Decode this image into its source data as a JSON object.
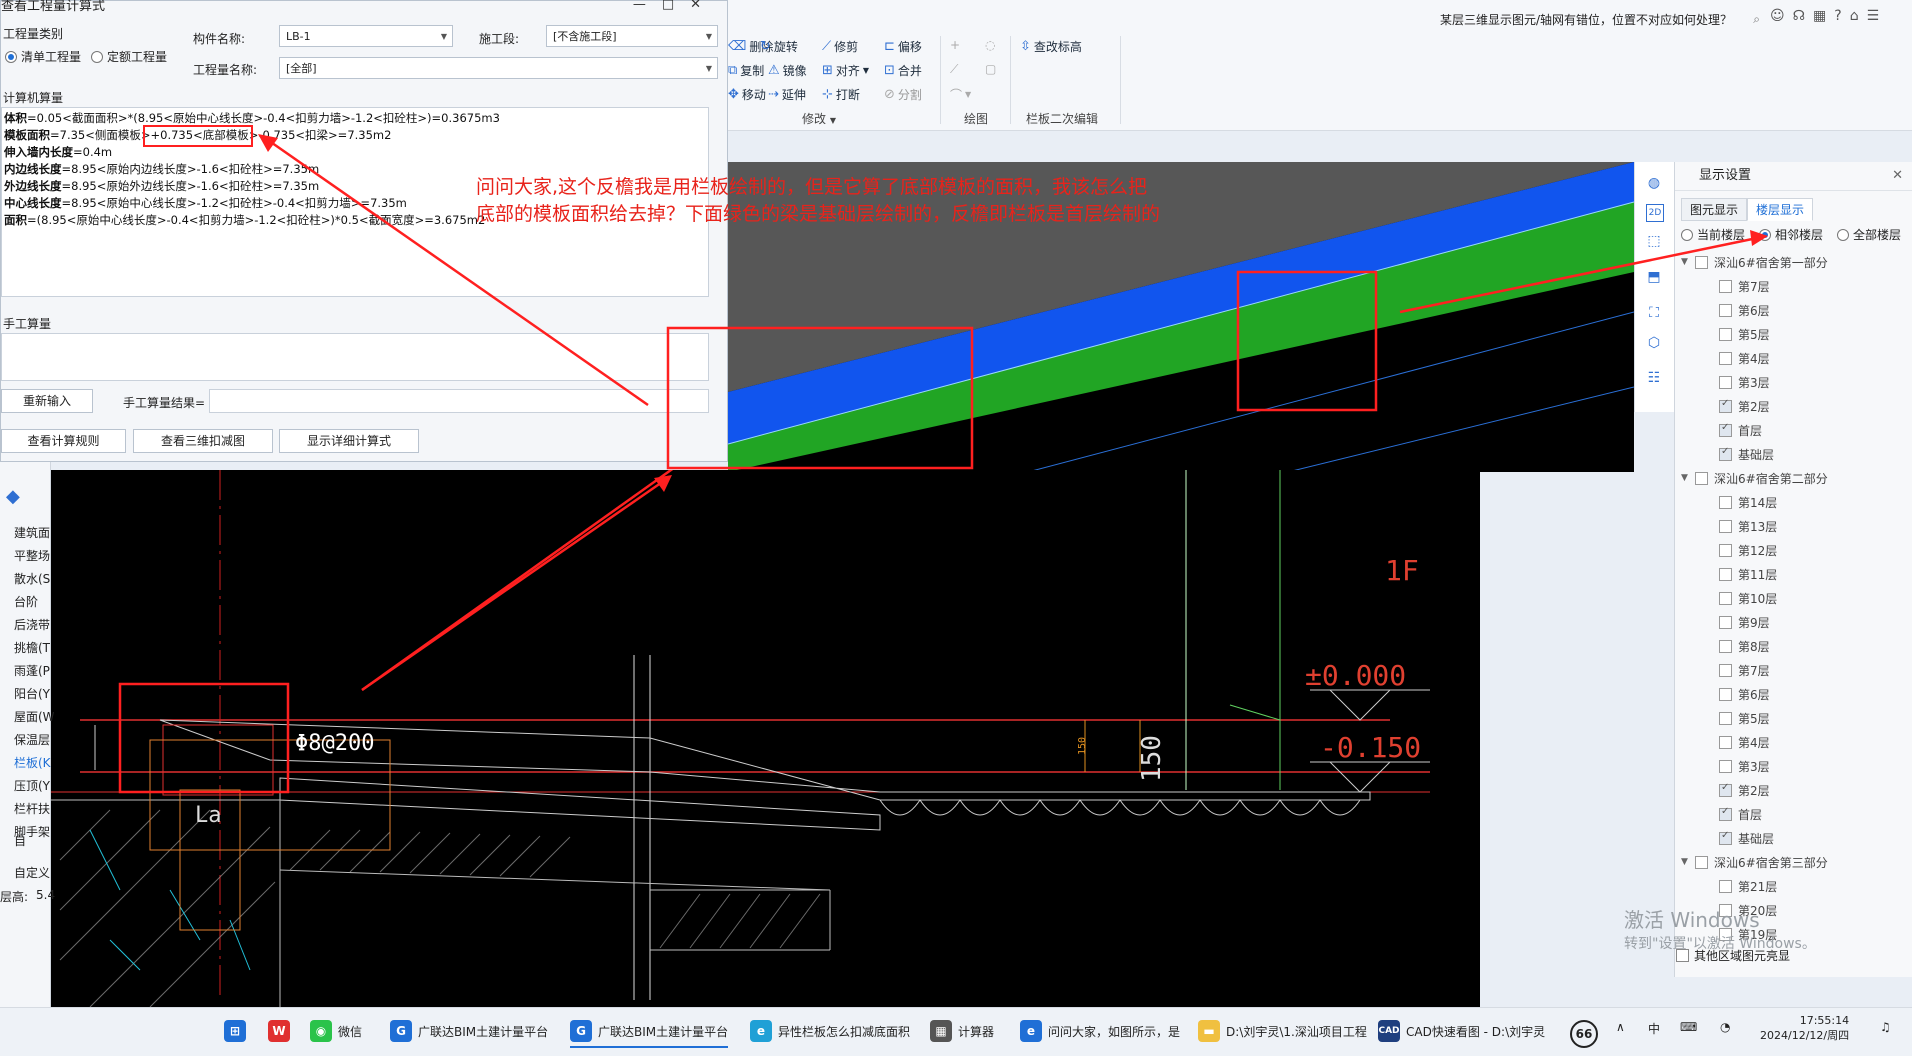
{
  "ribbon": {
    "modify": {
      "delete": "删除",
      "rotate": "旋转",
      "trim": "修剪",
      "offset": "偏移",
      "copy": "复制",
      "mirror": "镜像",
      "align": "对齐",
      "merge": "合并",
      "move": "移动",
      "extend": "延伸",
      "break": "打断",
      "split": "分割",
      "group": "修改"
    },
    "draw_group": "绘图",
    "edit": {
      "check_elevation": "查改标高",
      "group": "栏板二次编辑"
    },
    "search_text": "某层三维显示图元/轴网有错位，位置不对应如何处理？"
  },
  "dialog": {
    "title": "查看工程量计算式",
    "quantity_type_label": "工程量类别",
    "radio_list": "清单工程量",
    "radio_quota": "定额工程量",
    "component_name_label": "构件名称:",
    "component_name_value": "LB-1",
    "construction_label": "施工段:",
    "construction_value": "[不含施工段]",
    "quantity_name_label": "工程量名称:",
    "quantity_name_value": "[全部]",
    "computer_calc_label": "计算机算量",
    "formulas": [
      {
        "name": "体积",
        "expr": "=0.05<截面面积>*(8.95<原始中心线长度>-0.4<扣剪力墙>-1.2<扣砼柱>)=0.3675m3"
      },
      {
        "name": "模板面积",
        "expr": "=7.35<侧面模板>+0.735<底部模板>-0.735<扣梁>=7.35m2"
      },
      {
        "name": "伸入墙内长度",
        "expr": "=0.4m"
      },
      {
        "name": "内边线长度",
        "expr": "=8.95<原始内边线长度>-1.6<扣砼柱>=7.35m"
      },
      {
        "name": "外边线长度",
        "expr": "=8.95<原始外边线长度>-1.6<扣砼柱>=7.35m"
      },
      {
        "name": "中心线长度",
        "expr": "=8.95<原始中心线长度>-1.2<扣砼柱>-0.4<扣剪力墙>=7.35m"
      },
      {
        "name": "面积",
        "expr": "=(8.95<原始中心线长度>-0.4<扣剪力墙>-1.2<扣砼柱>)*0.5<截面宽度>=3.675m2"
      }
    ],
    "manual_calc_label": "手工算量",
    "reenter_btn": "重新输入",
    "manual_result_label": "手工算量结果=",
    "rules_btn": "查看计算规则",
    "deduct3d_btn": "查看三维扣减图",
    "detail_btn": "显示详细计算式"
  },
  "question_text": [
    "问问大家,这个反檐我是用栏板绘制的，但是它算了底部模板的面积，我该怎么把",
    "底部的模板面积给去掉？下面绿色的梁是基础层绘制的，反檐即栏板是首层绘制的"
  ],
  "left_list": [
    "建筑面",
    "平整场",
    "散水(S",
    "台阶",
    "后浇带",
    "挑檐(T",
    "雨蓬(P",
    "阳台(Y",
    "屋面(W",
    "保温层",
    "栏板(K",
    "压顶(Y",
    "栏杆扶",
    "脚手架",
    "自",
    "自定义",
    "层高:",
    "5.4"
  ],
  "display_panel": {
    "title": "显示设置",
    "tab_elements": "图元显示",
    "tab_floors": "楼层显示",
    "radio_current": "当前楼层",
    "radio_adjacent": "相邻楼层",
    "radio_all": "全部楼层",
    "tree": [
      {
        "label": "深汕6#宿舍第一部分",
        "root": true,
        "checked": false
      },
      {
        "label": "第7层",
        "checked": false
      },
      {
        "label": "第6层",
        "checked": false
      },
      {
        "label": "第5层",
        "checked": false
      },
      {
        "label": "第4层",
        "checked": false
      },
      {
        "label": "第3层",
        "checked": false
      },
      {
        "label": "第2层",
        "checked": true
      },
      {
        "label": "首层",
        "checked": true
      },
      {
        "label": "基础层",
        "checked": true
      },
      {
        "label": "深汕6#宿舍第二部分",
        "root": true,
        "checked": false
      },
      {
        "label": "第14层",
        "checked": false
      },
      {
        "label": "第13层",
        "checked": false
      },
      {
        "label": "第12层",
        "checked": false
      },
      {
        "label": "第11层",
        "checked": false
      },
      {
        "label": "第10层",
        "checked": false
      },
      {
        "label": "第9层",
        "checked": false
      },
      {
        "label": "第8层",
        "checked": false
      },
      {
        "label": "第7层",
        "checked": false
      },
      {
        "label": "第6层",
        "checked": false
      },
      {
        "label": "第5层",
        "checked": false
      },
      {
        "label": "第4层",
        "checked": false
      },
      {
        "label": "第3层",
        "checked": false
      },
      {
        "label": "第2层",
        "checked": true
      },
      {
        "label": "首层",
        "checked": true
      },
      {
        "label": "基础层",
        "checked": true
      },
      {
        "label": "深汕6#宿舍第三部分",
        "root": true,
        "checked": false
      },
      {
        "label": "第21层",
        "checked": false
      },
      {
        "label": "第20层",
        "checked": false
      },
      {
        "label": "第19层",
        "checked": false
      }
    ],
    "other_region": "其他区域图元亮显",
    "watermark_1": "激活 Windows",
    "watermark_2": "转到\"设置\"以激活 Windows。"
  },
  "cad": {
    "floor_label": "1F",
    "elev_0": "±0.000",
    "elev_1": "-0.150",
    "dim_150": "150",
    "dim_150_small": "150",
    "rebar": "Φ8@200",
    "la": "La"
  },
  "taskbar": {
    "wechat": "微信",
    "app1": "广联达BIM土建计量平台",
    "app2": "广联达BIM土建计量平台",
    "edge": "异性栏板怎么扣减底面积",
    "calc": "计算器",
    "ie": "问问大家，如图所示，是",
    "folder": "D:\\刘宇灵\\1.深汕项目工程",
    "cad": "CAD快速看图 - D:\\刘宇灵",
    "badge": "66",
    "ime": "中",
    "time": "17:55:14",
    "date": "2024/12/12/周四"
  },
  "colors": {
    "accent": "#1f6fd6",
    "annotation": "#e8231b",
    "green_beam": "#21a524",
    "blue_slab": "#1155ee"
  }
}
